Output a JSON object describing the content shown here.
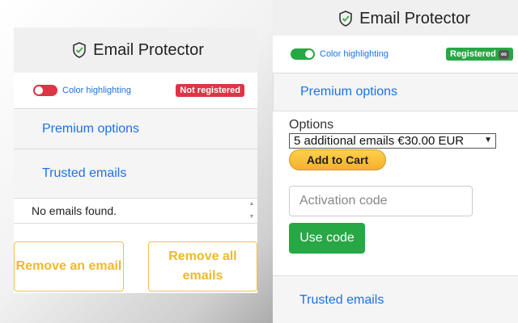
{
  "app": {
    "title": "Email Protector"
  },
  "left_popup": {
    "toggle_label": "Color highlighting",
    "toggle_state": "off",
    "badge": "Not registered",
    "premium_label": "Premium options",
    "trusted_label": "Trusted emails",
    "empty_list": "No emails found.",
    "remove_button": "Remove an email",
    "remove_all_button": "Remove all emails"
  },
  "right_popup": {
    "toggle_label": "Color highlighting",
    "toggle_state": "on",
    "badge": "Registered",
    "badge_icon": "∞",
    "premium_label": "Premium options",
    "options_label": "Options",
    "selected_option": "5 additional emails €30.00 EUR",
    "add_to_cart": "Add to Cart",
    "activation_placeholder": "Activation code",
    "use_code_button": "Use code",
    "trusted_label": "Trusted emails"
  },
  "colors": {
    "link_blue": "#1a73e8",
    "danger": "#dc3545",
    "success": "#28a745",
    "warning": "#f0b92a"
  },
  "icons": {
    "logo": "shield-check-icon",
    "select_caret": "chevron-down-icon",
    "scroll": "scroll-arrow-icon"
  }
}
